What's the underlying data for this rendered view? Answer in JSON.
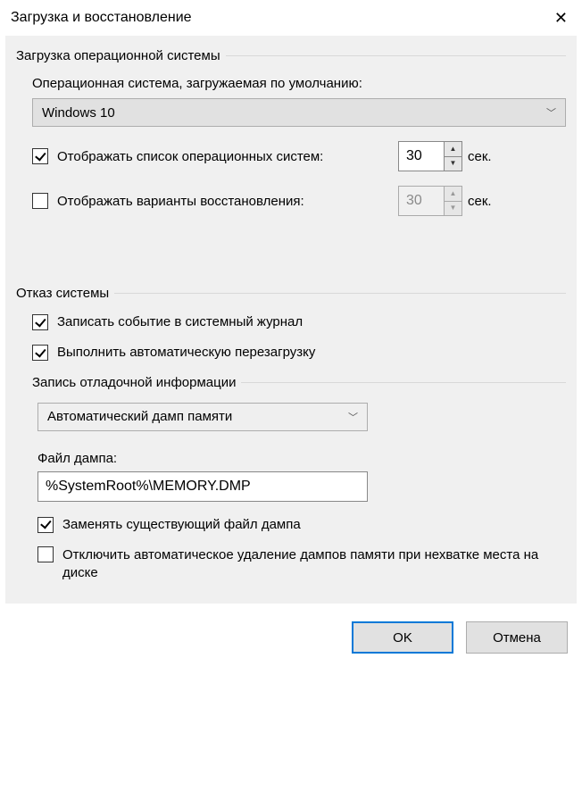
{
  "window": {
    "title": "Загрузка и восстановление"
  },
  "startup": {
    "group_label": "Загрузка операционной системы",
    "default_os_label": "Операционная система, загружаемая по умолчанию:",
    "default_os_value": "Windows 10",
    "show_os_list": {
      "label": "Отображать список операционных систем:",
      "checked": true,
      "value": "30",
      "suffix": "сек."
    },
    "show_recovery": {
      "label": "Отображать варианты восстановления:",
      "checked": false,
      "value": "30",
      "suffix": "сек."
    }
  },
  "failure": {
    "group_label": "Отказ системы",
    "log_event": {
      "label": "Записать событие в системный журнал",
      "checked": true
    },
    "auto_restart": {
      "label": "Выполнить автоматическую перезагрузку",
      "checked": true
    },
    "debug_info": {
      "group_label": "Запись отладочной информации",
      "dump_type": "Автоматический дамп памяти",
      "dump_file_label": "Файл дампа:",
      "dump_file_value": "%SystemRoot%\\MEMORY.DMP",
      "overwrite": {
        "label": "Заменять существующий файл дампа",
        "checked": true
      },
      "disable_auto_delete": {
        "label": "Отключить автоматическое удаление дампов памяти при нехватке места на диске",
        "checked": false
      }
    }
  },
  "buttons": {
    "ok": "OK",
    "cancel": "Отмена"
  }
}
